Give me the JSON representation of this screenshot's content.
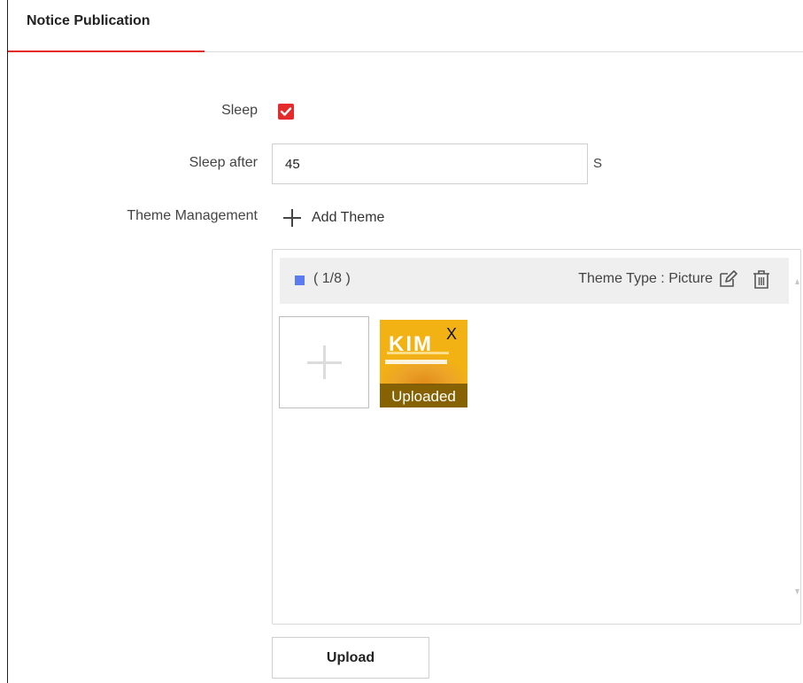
{
  "tab": {
    "label": "Notice Publication"
  },
  "form": {
    "sleep_label": "Sleep",
    "sleep_checked": true,
    "sleep_after_label": "Sleep after",
    "sleep_after_value": "45",
    "sleep_after_unit": "S",
    "theme_management_label": "Theme Management",
    "add_theme_label": "Add Theme"
  },
  "theme": {
    "index": "( 1/8 )",
    "swatch_color": "#5b7bf0",
    "type_label": "Theme Type : Picture",
    "items": [
      {
        "status": "Uploaded",
        "close": "X",
        "logo_text": "KIM"
      }
    ]
  },
  "upload_button": "Upload",
  "colors": {
    "accent": "#e32b2b"
  }
}
